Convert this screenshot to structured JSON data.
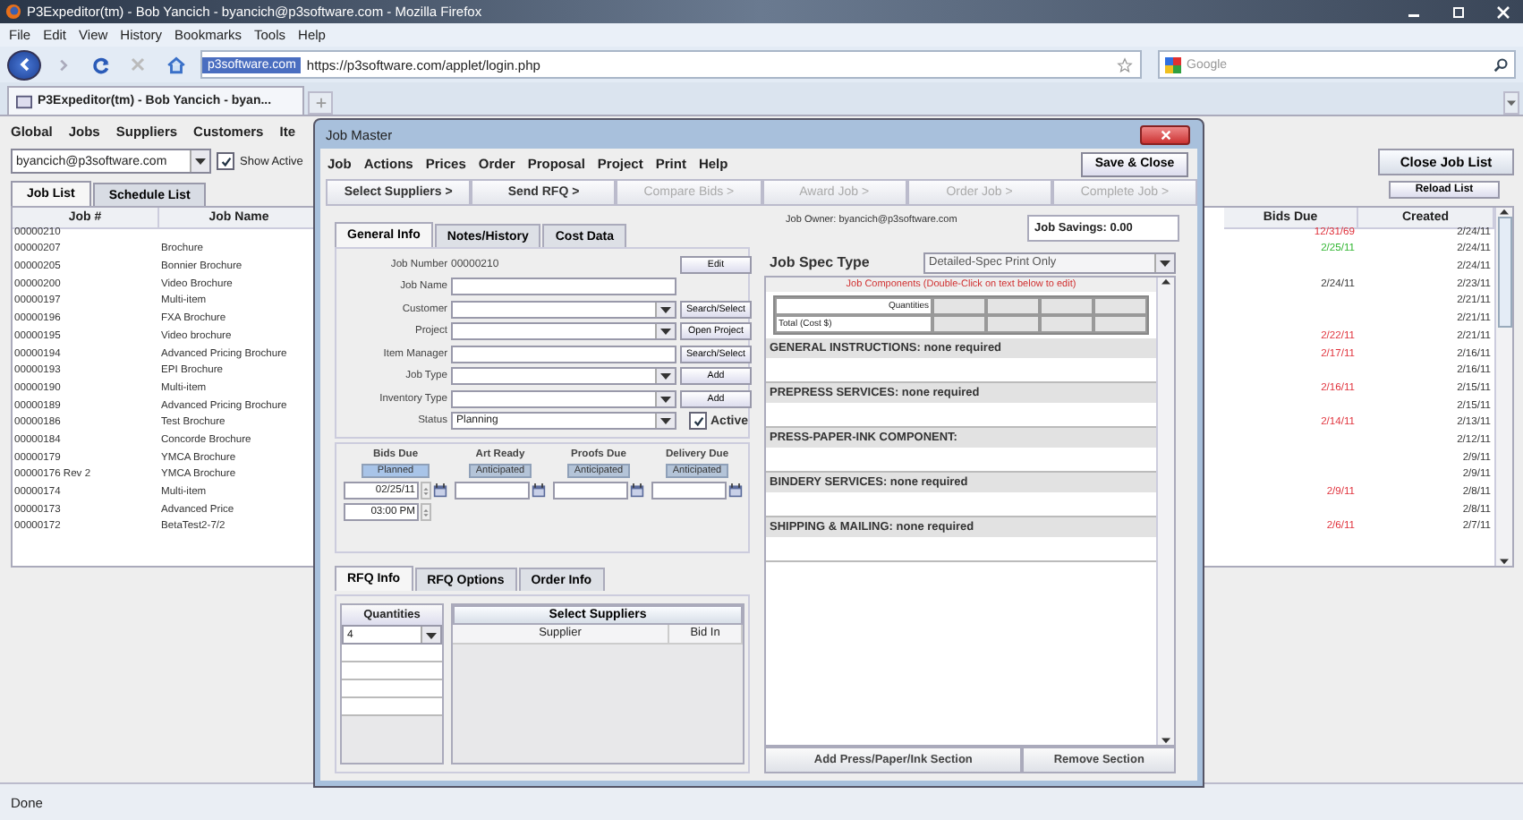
{
  "browser": {
    "title": "P3Expeditor(tm) - Bob Yancich - byancich@p3software.com - Mozilla Firefox",
    "menu": [
      "File",
      "Edit",
      "View",
      "History",
      "Bookmarks",
      "Tools",
      "Help"
    ],
    "site_badge": "p3software.com",
    "url": "https://p3software.com/applet/login.php",
    "search_placeholder": "Google",
    "tab": "P3Expeditor(tm) - Bob Yancich - byan...",
    "status": "Done"
  },
  "app": {
    "menu": [
      "Global",
      "Jobs",
      "Suppliers",
      "Customers",
      "Ite"
    ],
    "user": "byancich@p3software.com",
    "show_active": {
      "label": "Show Active",
      "checked": true
    },
    "tabs": [
      {
        "label": "Job List",
        "selected": true
      },
      {
        "label": "Schedule List",
        "selected": false
      }
    ],
    "close_button": "Close Job List",
    "reload_button": "Reload List",
    "columns": [
      "Job #",
      "Job Name",
      "Bids Due",
      "Created"
    ],
    "rows": [
      {
        "job": "00000210",
        "bids_due": "12/31/69",
        "color": "#e0303a",
        "created": "2/24/11"
      },
      {
        "job": "00000207",
        "name": "Brochure",
        "bids_due": "2/25/11",
        "color": "#2fb52f",
        "created": "2/24/11"
      },
      {
        "job": "00000205",
        "name": "Bonnier Brochure",
        "created": "2/24/11"
      },
      {
        "job": "00000200",
        "name": "Video Brochure",
        "bids_due": "2/24/11",
        "color": "#333333",
        "created": "2/23/11"
      },
      {
        "job": "00000197",
        "name": "Multi-item",
        "created": "2/21/11"
      },
      {
        "job": "00000196",
        "name": "FXA Brochure",
        "created": "2/21/11"
      },
      {
        "job": "00000195",
        "name": "Video brochure",
        "bids_due": "2/22/11",
        "color": "#e0303a",
        "created": "2/21/11"
      },
      {
        "job": "00000194",
        "name": "Advanced Pricing Brochure",
        "bids_due": "2/17/11",
        "color": "#e0303a",
        "created": "2/16/11"
      },
      {
        "job": "00000193",
        "name": "EPI Brochure",
        "created": "2/16/11"
      },
      {
        "job": "00000190",
        "name": "Multi-item",
        "bids_due": "2/16/11",
        "color": "#e0303a",
        "created": "2/15/11"
      },
      {
        "job": "00000189",
        "name": "Advanced Pricing Brochure",
        "created": "2/15/11"
      },
      {
        "job": "00000186",
        "name": "Test Brochure",
        "bids_due": "2/14/11",
        "color": "#e0303a",
        "created": "2/13/11"
      },
      {
        "job": "00000184",
        "name": "Concorde Brochure",
        "created": "2/12/11"
      },
      {
        "job": "00000179",
        "name": "YMCA Brochure",
        "created": "2/9/11"
      },
      {
        "job": "00000176 Rev 2",
        "name": "YMCA Brochure",
        "created": "2/9/11"
      },
      {
        "job": "00000174",
        "name": "Multi-item",
        "bids_due": "2/9/11",
        "color": "#e0303a",
        "created": "2/8/11"
      },
      {
        "job": "00000173",
        "name": "Advanced Price",
        "created": "2/8/11"
      },
      {
        "job": "00000172",
        "name": "BetaTest2-7/2",
        "bids_due": "2/6/11",
        "color": "#e0303a",
        "created": "2/7/11"
      }
    ]
  },
  "dialog": {
    "title": "Job Master",
    "menu": [
      "Job",
      "Actions",
      "Prices",
      "Order",
      "Proposal",
      "Project",
      "Print",
      "Help"
    ],
    "save_button": "Save & Close",
    "steps": [
      {
        "label": "Select Suppliers >",
        "disabled": false
      },
      {
        "label": "Send RFQ >",
        "disabled": false
      },
      {
        "label": "Compare Bids >",
        "disabled": true
      },
      {
        "label": "Award Job >",
        "disabled": true
      },
      {
        "label": "Order Job >",
        "disabled": true
      },
      {
        "label": "Complete Job >",
        "disabled": true
      }
    ],
    "owner": "Job Owner: byancich@p3software.com",
    "savings": "Job Savings: 0.00",
    "tabs": [
      {
        "label": "General Info",
        "selected": true
      },
      {
        "label": "Notes/History",
        "selected": false
      },
      {
        "label": "Cost Data",
        "selected": false
      }
    ],
    "fields": [
      {
        "label": "Job Number",
        "kind": "text",
        "value": "00000210",
        "button": "Edit"
      },
      {
        "label": "Job Name",
        "kind": "input"
      },
      {
        "label": "Customer",
        "kind": "combo",
        "button": "Search/Select"
      },
      {
        "label": "Project",
        "kind": "combo",
        "button": "Open Project"
      },
      {
        "label": "Item Manager",
        "kind": "input",
        "button": "Search/Select"
      },
      {
        "label": "Job Type",
        "kind": "combo",
        "button": "Add"
      },
      {
        "label": "Inventory Type",
        "kind": "combo",
        "button": "Add"
      },
      {
        "label": "Status",
        "kind": "combo",
        "value": "Planning"
      }
    ],
    "active": {
      "label": "Active",
      "checked": true
    },
    "dates": [
      {
        "label": "Bids Due",
        "badge": "Planned",
        "date": "02/25/11",
        "time": "03:00 PM"
      },
      {
        "label": "Art Ready",
        "badge": "Anticipated"
      },
      {
        "label": "Proofs Due",
        "badge": "Anticipated"
      },
      {
        "label": "Delivery Due",
        "badge": "Anticipated"
      }
    ],
    "rfq_tabs": [
      {
        "label": "RFQ Info",
        "selected": true
      },
      {
        "label": "RFQ Options",
        "selected": false
      },
      {
        "label": "Order Info",
        "selected": false
      }
    ],
    "quantities": {
      "header": "Quantities",
      "value": "4"
    },
    "suppliers": {
      "button": "Select Suppliers",
      "columns": [
        "Supplier",
        "Bid In"
      ]
    },
    "spec": {
      "label": "Job Spec Type",
      "value": "Detailed-Spec Print Only",
      "note": "Job Components (Double-Click on text below to edit)",
      "grid_rows": [
        "Quantities",
        "Total (Cost $)"
      ],
      "sections": [
        "GENERAL INSTRUCTIONS: none required",
        "PREPRESS SERVICES: none required",
        "PRESS-PAPER-INK COMPONENT:",
        "BINDERY SERVICES: none required",
        "SHIPPING & MAILING: none required"
      ],
      "buttons": [
        "Add Press/Paper/Ink Section",
        "Remove Section"
      ]
    }
  }
}
